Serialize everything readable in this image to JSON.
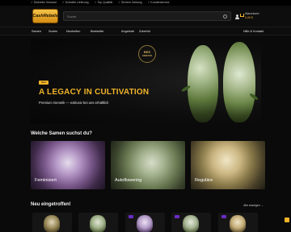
{
  "topbar": {
    "items": [
      "✓ Diskreter Versand",
      "✓ Schnelle Lieferung",
      "✓ Top Qualität",
      "✓ Sichere Zahlung",
      "✓ Kundenservice"
    ]
  },
  "header": {
    "logo_text": "CashRebels",
    "search_placeholder": "Suche",
    "cart_label": "Warenkorb",
    "cart_amount": "0,00 €"
  },
  "nav": {
    "items": [
      "Samen",
      "Sorten",
      "Neuheiten",
      "Bestseller",
      "Angebote",
      "Zubehör"
    ],
    "right": "Hilfe & Kontakt"
  },
  "hero": {
    "badge_top": "BES",
    "badge_bottom": "GENETICS",
    "tag": "NEU",
    "title": "A LEGACY IN CULTIVATION",
    "subtitle": "Premium Genetik — exklusiv bei uns erhältlich"
  },
  "categories": {
    "title": "Welche Samen suchst du?",
    "items": [
      {
        "label": "Feminisiert"
      },
      {
        "label": "Autoflowering"
      },
      {
        "label": "Reguläre"
      }
    ]
  },
  "new_arrivals": {
    "title": "Neu eingetroffen!",
    "more": "Alle anzeigen →"
  }
}
